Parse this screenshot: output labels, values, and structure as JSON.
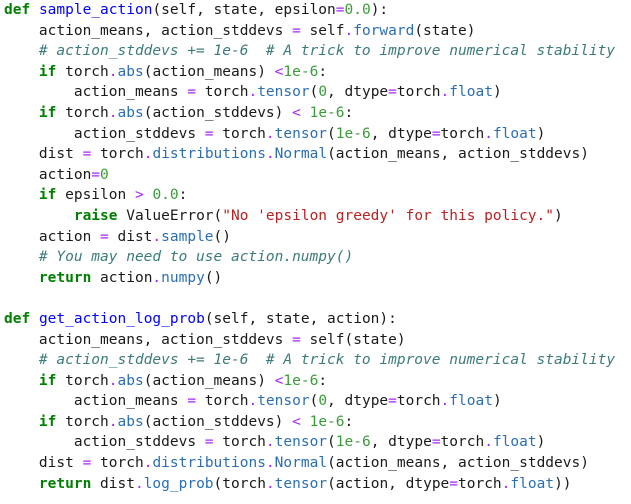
{
  "code": [
    [
      [
        "k",
        "def"
      ],
      [
        "p",
        " "
      ],
      [
        "f",
        "sample_action"
      ],
      [
        "p",
        "(self, state, epsilon"
      ],
      [
        "o",
        "="
      ],
      [
        "n",
        "0.0"
      ],
      [
        "p",
        "):"
      ]
    ],
    [
      [
        "p",
        "    action_means, action_stddevs "
      ],
      [
        "o",
        "="
      ],
      [
        "p",
        " self"
      ],
      [
        "o",
        "."
      ],
      [
        "a",
        "forward"
      ],
      [
        "p",
        "(state)"
      ]
    ],
    [
      [
        "c",
        "    # action_stddevs += 1e-6  # A trick to improve numerical stability"
      ]
    ],
    [
      [
        "p",
        "    "
      ],
      [
        "k",
        "if"
      ],
      [
        "p",
        " torch"
      ],
      [
        "o",
        "."
      ],
      [
        "a",
        "abs"
      ],
      [
        "p",
        "(action_means) "
      ],
      [
        "o",
        "<"
      ],
      [
        "n",
        "1e-6"
      ],
      [
        "p",
        ":"
      ]
    ],
    [
      [
        "p",
        "        action_means "
      ],
      [
        "o",
        "="
      ],
      [
        "p",
        " torch"
      ],
      [
        "o",
        "."
      ],
      [
        "a",
        "tensor"
      ],
      [
        "p",
        "("
      ],
      [
        "n",
        "0"
      ],
      [
        "p",
        ", dtype"
      ],
      [
        "o",
        "="
      ],
      [
        "p",
        "torch"
      ],
      [
        "o",
        "."
      ],
      [
        "a",
        "float"
      ],
      [
        "p",
        ")"
      ]
    ],
    [
      [
        "p",
        "    "
      ],
      [
        "k",
        "if"
      ],
      [
        "p",
        " torch"
      ],
      [
        "o",
        "."
      ],
      [
        "a",
        "abs"
      ],
      [
        "p",
        "(action_stddevs) "
      ],
      [
        "o",
        "<"
      ],
      [
        "p",
        " "
      ],
      [
        "n",
        "1e-6"
      ],
      [
        "p",
        ":"
      ]
    ],
    [
      [
        "p",
        "        action_stddevs "
      ],
      [
        "o",
        "="
      ],
      [
        "p",
        " torch"
      ],
      [
        "o",
        "."
      ],
      [
        "a",
        "tensor"
      ],
      [
        "p",
        "("
      ],
      [
        "n",
        "1e-6"
      ],
      [
        "p",
        ", dtype"
      ],
      [
        "o",
        "="
      ],
      [
        "p",
        "torch"
      ],
      [
        "o",
        "."
      ],
      [
        "a",
        "float"
      ],
      [
        "p",
        ")"
      ]
    ],
    [
      [
        "p",
        "    dist "
      ],
      [
        "o",
        "="
      ],
      [
        "p",
        " torch"
      ],
      [
        "o",
        "."
      ],
      [
        "a",
        "distributions"
      ],
      [
        "o",
        "."
      ],
      [
        "a",
        "Normal"
      ],
      [
        "p",
        "(action_means, action_stddevs)"
      ]
    ],
    [
      [
        "p",
        "    action"
      ],
      [
        "o",
        "="
      ],
      [
        "n",
        "0"
      ]
    ],
    [
      [
        "p",
        "    "
      ],
      [
        "k",
        "if"
      ],
      [
        "p",
        " epsilon "
      ],
      [
        "o",
        ">"
      ],
      [
        "p",
        " "
      ],
      [
        "n",
        "0.0"
      ],
      [
        "p",
        ":"
      ]
    ],
    [
      [
        "p",
        "        "
      ],
      [
        "k",
        "raise"
      ],
      [
        "p",
        " ValueError("
      ],
      [
        "s",
        "\"No 'epsilon greedy' for this policy.\""
      ],
      [
        "p",
        ")"
      ]
    ],
    [
      [
        "p",
        "    action "
      ],
      [
        "o",
        "="
      ],
      [
        "p",
        " dist"
      ],
      [
        "o",
        "."
      ],
      [
        "a",
        "sample"
      ],
      [
        "p",
        "()"
      ]
    ],
    [
      [
        "c",
        "    # You may need to use action.numpy()"
      ]
    ],
    [
      [
        "p",
        "    "
      ],
      [
        "k",
        "return"
      ],
      [
        "p",
        " action"
      ],
      [
        "o",
        "."
      ],
      [
        "a",
        "numpy"
      ],
      [
        "p",
        "()"
      ]
    ],
    [],
    [
      [
        "k",
        "def"
      ],
      [
        "p",
        " "
      ],
      [
        "f",
        "get_action_log_prob"
      ],
      [
        "p",
        "(self, state, action):"
      ]
    ],
    [
      [
        "p",
        "    action_means, action_stddevs "
      ],
      [
        "o",
        "="
      ],
      [
        "p",
        " self(state)"
      ]
    ],
    [
      [
        "c",
        "    # action_stddevs += 1e-6  # A trick to improve numerical stability"
      ]
    ],
    [
      [
        "p",
        "    "
      ],
      [
        "k",
        "if"
      ],
      [
        "p",
        " torch"
      ],
      [
        "o",
        "."
      ],
      [
        "a",
        "abs"
      ],
      [
        "p",
        "(action_means) "
      ],
      [
        "o",
        "<"
      ],
      [
        "n",
        "1e-6"
      ],
      [
        "p",
        ":"
      ]
    ],
    [
      [
        "p",
        "        action_means "
      ],
      [
        "o",
        "="
      ],
      [
        "p",
        " torch"
      ],
      [
        "o",
        "."
      ],
      [
        "a",
        "tensor"
      ],
      [
        "p",
        "("
      ],
      [
        "n",
        "0"
      ],
      [
        "p",
        ", dtype"
      ],
      [
        "o",
        "="
      ],
      [
        "p",
        "torch"
      ],
      [
        "o",
        "."
      ],
      [
        "a",
        "float"
      ],
      [
        "p",
        ")"
      ]
    ],
    [
      [
        "p",
        "    "
      ],
      [
        "k",
        "if"
      ],
      [
        "p",
        " torch"
      ],
      [
        "o",
        "."
      ],
      [
        "a",
        "abs"
      ],
      [
        "p",
        "(action_stddevs) "
      ],
      [
        "o",
        "<"
      ],
      [
        "p",
        " "
      ],
      [
        "n",
        "1e-6"
      ],
      [
        "p",
        ":"
      ]
    ],
    [
      [
        "p",
        "        action_stddevs "
      ],
      [
        "o",
        "="
      ],
      [
        "p",
        " torch"
      ],
      [
        "o",
        "."
      ],
      [
        "a",
        "tensor"
      ],
      [
        "p",
        "("
      ],
      [
        "n",
        "1e-6"
      ],
      [
        "p",
        ", dtype"
      ],
      [
        "o",
        "="
      ],
      [
        "p",
        "torch"
      ],
      [
        "o",
        "."
      ],
      [
        "a",
        "float"
      ],
      [
        "p",
        ")"
      ]
    ],
    [
      [
        "p",
        "    dist "
      ],
      [
        "o",
        "="
      ],
      [
        "p",
        " torch"
      ],
      [
        "o",
        "."
      ],
      [
        "a",
        "distributions"
      ],
      [
        "o",
        "."
      ],
      [
        "a",
        "Normal"
      ],
      [
        "p",
        "(action_means, action_stddevs)"
      ]
    ],
    [
      [
        "p",
        "    "
      ],
      [
        "k",
        "return"
      ],
      [
        "p",
        " dist"
      ],
      [
        "o",
        "."
      ],
      [
        "a",
        "log_prob"
      ],
      [
        "p",
        "(torch"
      ],
      [
        "o",
        "."
      ],
      [
        "a",
        "tensor"
      ],
      [
        "p",
        "(action, dtype"
      ],
      [
        "o",
        "="
      ],
      [
        "p",
        "torch"
      ],
      [
        "o",
        "."
      ],
      [
        "a",
        "float"
      ],
      [
        "p",
        "))"
      ]
    ]
  ]
}
